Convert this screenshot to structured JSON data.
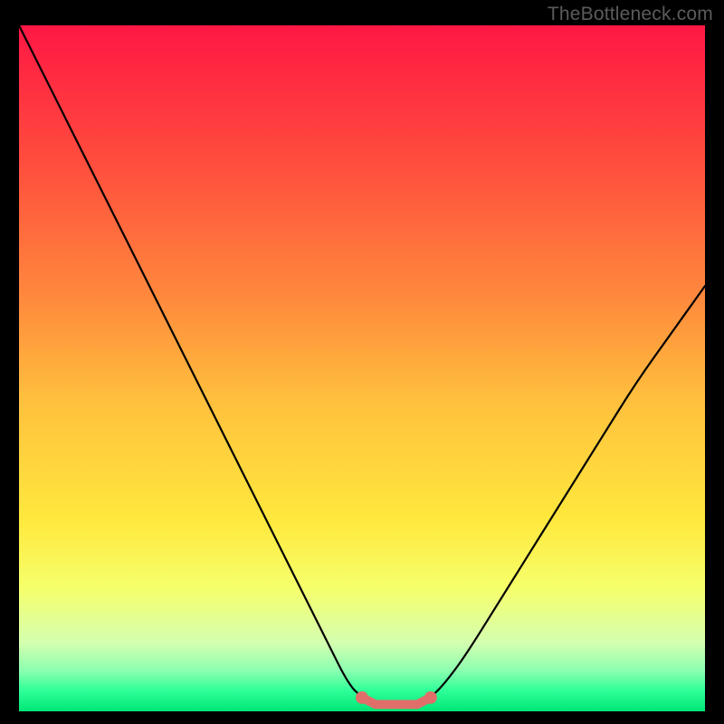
{
  "watermark": "TheBottleneck.com",
  "chart_data": {
    "type": "line",
    "title": "",
    "xlabel": "",
    "ylabel": "",
    "xlim": [
      0,
      100
    ],
    "ylim": [
      0,
      100
    ],
    "series": [
      {
        "name": "bottleneck-curve",
        "x": [
          0,
          5,
          10,
          15,
          20,
          25,
          30,
          35,
          40,
          45,
          48,
          50,
          52,
          54,
          56,
          58,
          60,
          62,
          65,
          70,
          75,
          80,
          85,
          90,
          95,
          100
        ],
        "values": [
          100,
          90,
          80,
          70,
          60,
          50,
          40,
          30,
          20,
          10,
          4,
          2,
          1,
          1,
          1,
          1,
          2,
          4,
          8,
          16,
          24,
          32,
          40,
          48,
          55,
          62
        ]
      },
      {
        "name": "optimal-range",
        "x": [
          50,
          52,
          54,
          56,
          58,
          60
        ],
        "values": [
          2,
          1,
          1,
          1,
          1,
          2
        ]
      }
    ],
    "annotations": [],
    "gradient_stops": [
      {
        "offset": 0.0,
        "color": "#ff1744"
      },
      {
        "offset": 0.2,
        "color": "#ff4d3d"
      },
      {
        "offset": 0.4,
        "color": "#ff8a3d"
      },
      {
        "offset": 0.55,
        "color": "#ffc13d"
      },
      {
        "offset": 0.72,
        "color": "#ffe83d"
      },
      {
        "offset": 0.82,
        "color": "#f6ff6b"
      },
      {
        "offset": 0.9,
        "color": "#d4ffb0"
      },
      {
        "offset": 0.94,
        "color": "#8dffb0"
      },
      {
        "offset": 0.97,
        "color": "#2eff98"
      },
      {
        "offset": 1.0,
        "color": "#00e676"
      }
    ],
    "curve_color": "#000000",
    "optimal_marker_color": "#e06f6a"
  }
}
